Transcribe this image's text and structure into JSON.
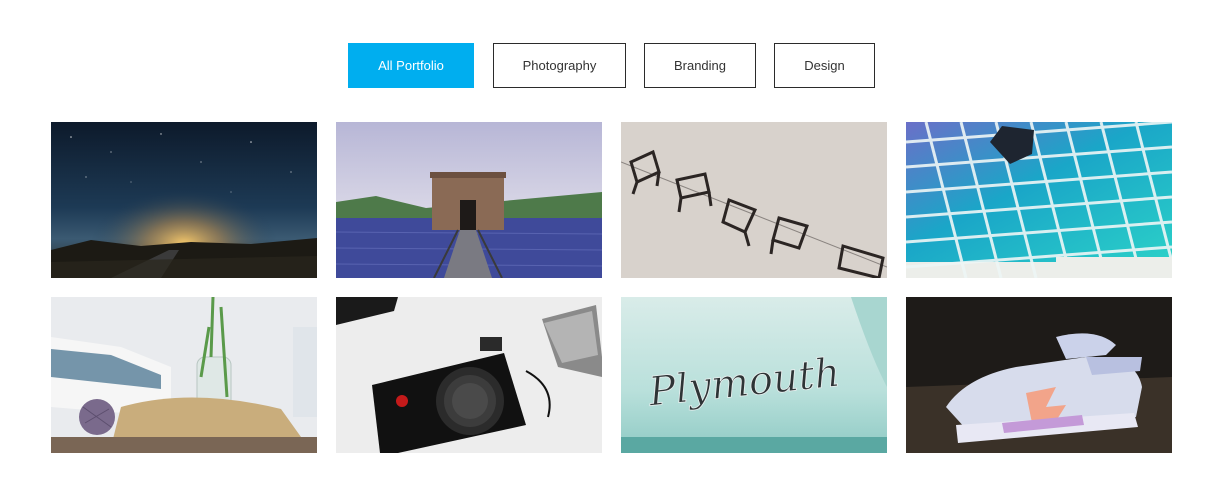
{
  "filters": [
    {
      "label": "All Portfolio",
      "active": true
    },
    {
      "label": "Photography",
      "active": false
    },
    {
      "label": "Branding",
      "active": false
    },
    {
      "label": "Design",
      "active": false
    }
  ],
  "colors": {
    "accent": "#00aeef",
    "border": "#2b2b2b"
  },
  "portfolio": {
    "items": [
      {
        "subject": "night-sky-road"
      },
      {
        "subject": "pier-tower-lake"
      },
      {
        "subject": "floating-chairs"
      },
      {
        "subject": "color-swatch-grid"
      },
      {
        "subject": "book-vase-twine"
      },
      {
        "subject": "leica-camera"
      },
      {
        "subject": "plymouth-emblem"
      },
      {
        "subject": "sneakers"
      }
    ],
    "emblem_text": "Plymouth"
  }
}
